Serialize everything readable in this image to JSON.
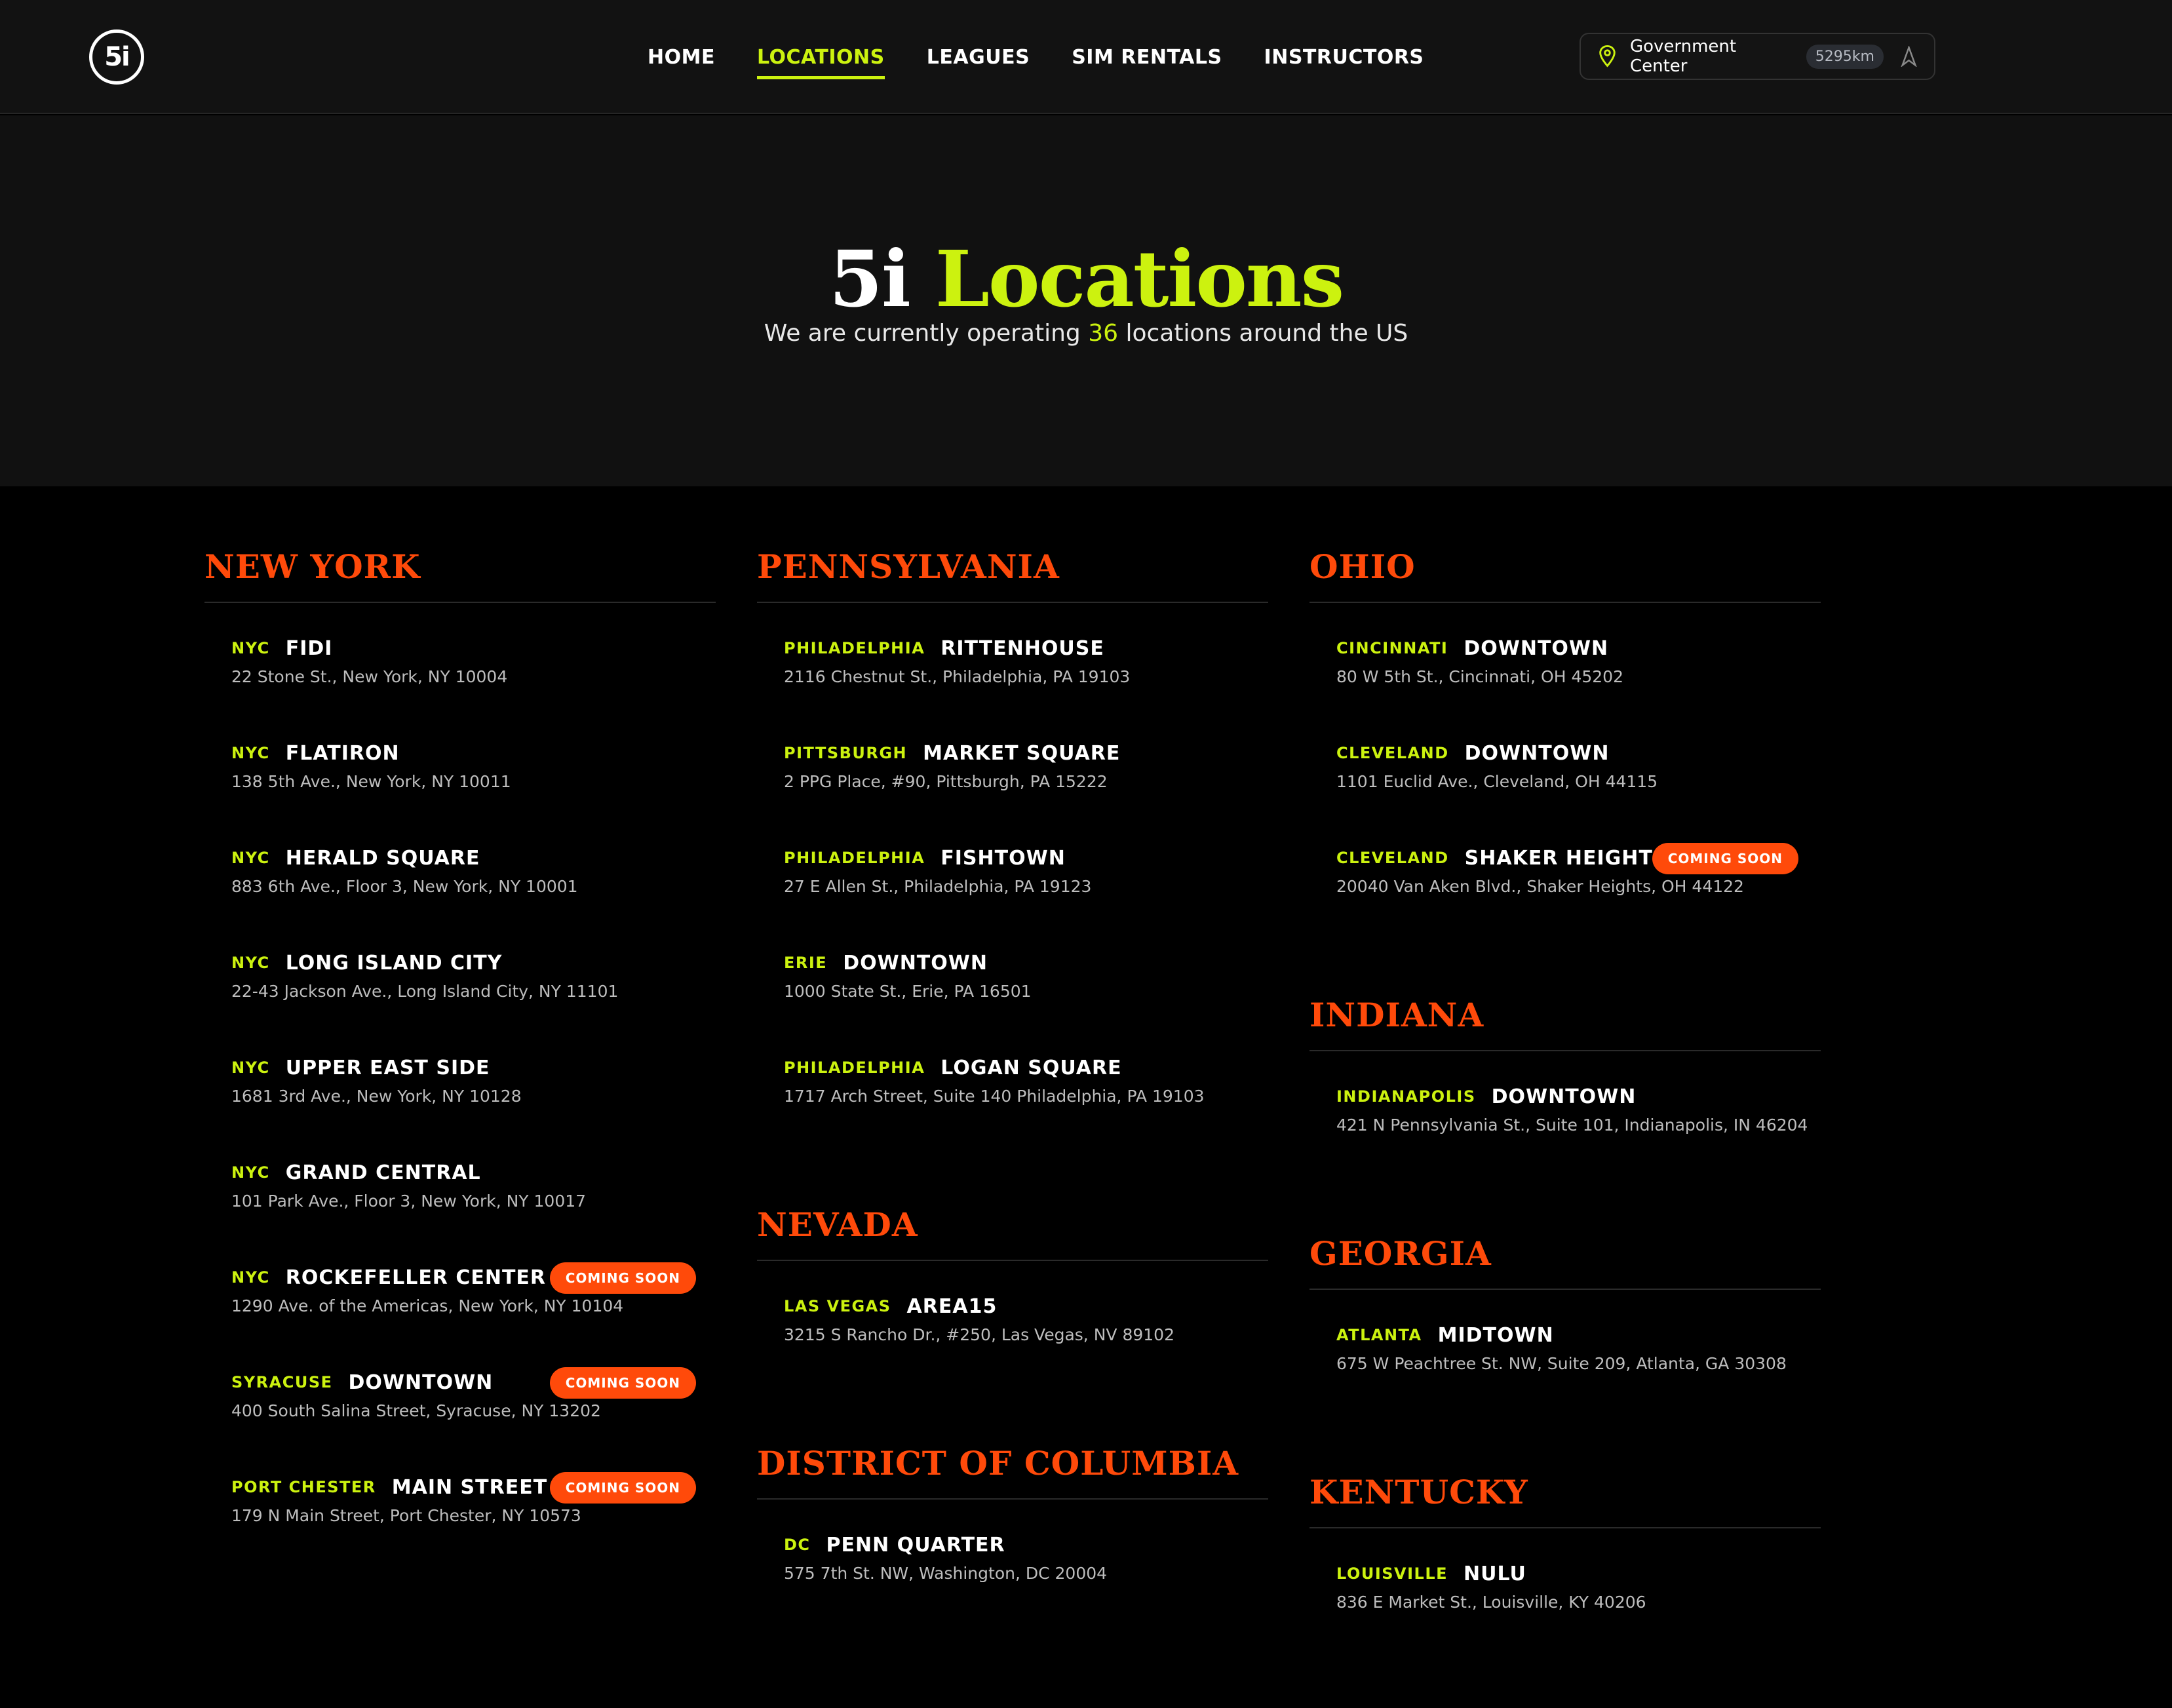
{
  "brand": {
    "logo_text": "5i"
  },
  "nav": {
    "items": [
      "HOME",
      "LOCATIONS",
      "LEAGUES",
      "SIM RENTALS",
      "INSTRUCTORS"
    ],
    "active": "LOCATIONS"
  },
  "location_selector": {
    "label": "Government Center",
    "distance": "5295km"
  },
  "hero": {
    "title_part1": "5i",
    "title_part2": "Locations",
    "subtitle_before": "We are currently operating",
    "count": "36",
    "subtitle_after": "locations around the US"
  },
  "colors": {
    "accent": "#ccf20f",
    "state": "#ff4a0a",
    "badge": "#ff4a0a"
  },
  "columns": [
    {
      "states": [
        {
          "name": "NEW YORK",
          "locations": [
            {
              "city": "NYC",
              "name": "FIDI",
              "address": "22 Stone St., New York, NY 10004",
              "badge": ""
            },
            {
              "city": "NYC",
              "name": "FLATIRON",
              "address": "138 5th Ave., New York, NY 10011",
              "badge": ""
            },
            {
              "city": "NYC",
              "name": "HERALD SQUARE",
              "address": "883 6th Ave., Floor 3, New York, NY 10001",
              "badge": ""
            },
            {
              "city": "NYC",
              "name": "LONG ISLAND CITY",
              "address": "22-43 Jackson Ave., Long Island City, NY 11101",
              "badge": ""
            },
            {
              "city": "NYC",
              "name": "UPPER EAST SIDE",
              "address": "1681 3rd Ave., New York, NY 10128",
              "badge": ""
            },
            {
              "city": "NYC",
              "name": "GRAND CENTRAL",
              "address": "101 Park Ave., Floor 3, New York, NY 10017",
              "badge": ""
            },
            {
              "city": "NYC",
              "name": "ROCKEFELLER CENTER",
              "address": "1290 Ave. of the Americas, New York, NY 10104",
              "badge": "COMING SOON"
            },
            {
              "city": "SYRACUSE",
              "name": "DOWNTOWN",
              "address": "400 South Salina Street, Syracuse, NY 13202",
              "badge": "COMING SOON"
            },
            {
              "city": "PORT CHESTER",
              "name": "MAIN STREET",
              "address": "179 N Main Street, Port Chester, NY 10573",
              "badge": "COMING SOON"
            }
          ]
        }
      ]
    },
    {
      "states": [
        {
          "name": "PENNSYLVANIA",
          "locations": [
            {
              "city": "PHILADELPHIA",
              "name": "RITTENHOUSE",
              "address": "2116 Chestnut St., Philadelphia, PA 19103",
              "badge": ""
            },
            {
              "city": "PITTSBURGH",
              "name": "MARKET SQUARE",
              "address": "2 PPG Place, #90, Pittsburgh, PA 15222",
              "badge": ""
            },
            {
              "city": "PHILADELPHIA",
              "name": "FISHTOWN",
              "address": "27 E Allen St., Philadelphia, PA 19123",
              "badge": ""
            },
            {
              "city": "ERIE",
              "name": "DOWNTOWN",
              "address": "1000 State St., Erie, PA 16501",
              "badge": ""
            },
            {
              "city": "PHILADELPHIA",
              "name": "LOGAN SQUARE",
              "address": "1717 Arch Street, Suite 140 Philadelphia, PA 19103",
              "badge": ""
            }
          ]
        },
        {
          "name": "NEVADA",
          "locations": [
            {
              "city": "LAS VEGAS",
              "name": "AREA15",
              "address": "3215 S Rancho Dr., #250, Las Vegas, NV 89102",
              "badge": ""
            }
          ]
        },
        {
          "name": "DISTRICT OF COLUMBIA",
          "locations": [
            {
              "city": "DC",
              "name": "PENN QUARTER",
              "address": "575 7th St. NW, Washington, DC 20004",
              "badge": ""
            }
          ]
        }
      ]
    },
    {
      "states": [
        {
          "name": "OHIO",
          "locations": [
            {
              "city": "CINCINNATI",
              "name": "DOWNTOWN",
              "address": "80 W 5th St., Cincinnati, OH 45202",
              "badge": ""
            },
            {
              "city": "CLEVELAND",
              "name": "DOWNTOWN",
              "address": "1101 Euclid Ave., Cleveland, OH 44115",
              "badge": ""
            },
            {
              "city": "CLEVELAND",
              "name": "SHAKER HEIGHTS",
              "address": "20040 Van Aken Blvd., Shaker Heights, OH 44122",
              "badge": "COMING SOON"
            }
          ]
        },
        {
          "name": "INDIANA",
          "locations": [
            {
              "city": "INDIANAPOLIS",
              "name": "DOWNTOWN",
              "address": "421 N Pennsylvania St., Suite 101, Indianapolis, IN 46204",
              "badge": ""
            }
          ]
        },
        {
          "name": "GEORGIA",
          "locations": [
            {
              "city": "ATLANTA",
              "name": "MIDTOWN",
              "address": "675 W Peachtree St. NW, Suite 209, Atlanta, GA 30308",
              "badge": ""
            }
          ]
        },
        {
          "name": "KENTUCKY",
          "locations": [
            {
              "city": "LOUISVILLE",
              "name": "NULU",
              "address": "836 E Market St., Louisville, KY 40206",
              "badge": ""
            }
          ]
        }
      ]
    }
  ]
}
